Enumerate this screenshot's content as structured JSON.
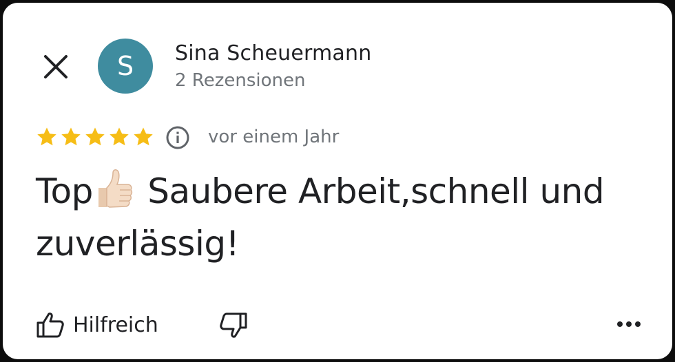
{
  "review": {
    "author_initial": "S",
    "author_name": "Sina Scheuermann",
    "author_reviews": "2 Rezensionen",
    "rating": 5,
    "rating_max": 5,
    "time_ago": "vor einem Jahr",
    "text_before_emoji": "Top",
    "text_after_emoji": " Saubere Arbeit,schnell und zuverlässig!"
  },
  "actions": {
    "helpful_label": "Hilfreich"
  },
  "icons": {
    "close": "close-icon",
    "info": "info-icon",
    "thumbs_up": "thumbs-up-icon",
    "thumbs_down": "thumbs-down-icon",
    "more": "more-horizontal-icon",
    "emoji": "thumbs-up-emoji"
  },
  "colors": {
    "avatar_bg": "#3f8c9f",
    "star": "#f6bd16",
    "text_primary": "#202124",
    "text_secondary": "#70757a"
  }
}
